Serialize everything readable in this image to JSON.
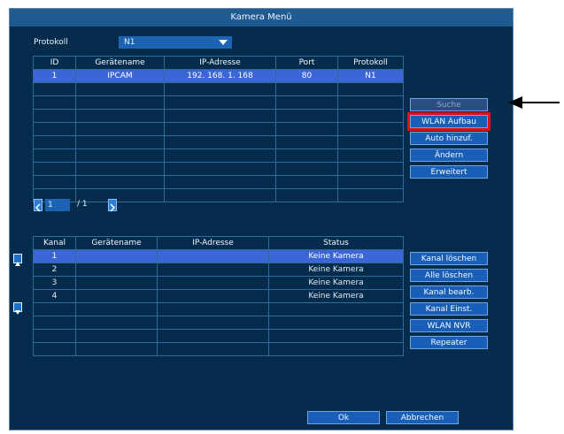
{
  "title": "Kamera Menü",
  "protokoll": {
    "label": "Protokoll",
    "value": "N1"
  },
  "cam_table": {
    "headers": [
      "ID",
      "Gerätename",
      "IP-Adresse",
      "Port",
      "Protokoll"
    ],
    "rows": [
      [
        "1",
        "IPCAM",
        "192. 168. 1. 168",
        "80",
        "N1"
      ]
    ]
  },
  "side_buttons": {
    "suche": "Suche",
    "wlan": "WLAN Aufbau",
    "auto": "Auto hinzuf.",
    "aendern": "Ändern",
    "erweitert": "Erweitert"
  },
  "pager": {
    "current": "1",
    "total": "/ 1"
  },
  "channel_table": {
    "headers": [
      "Kanal",
      "Gerätename",
      "IP-Adresse",
      "Status"
    ],
    "rows": [
      [
        "1",
        "",
        "",
        "Keine Kamera"
      ],
      [
        "2",
        "",
        "",
        "Keine Kamera"
      ],
      [
        "3",
        "",
        "",
        "Keine Kamera"
      ],
      [
        "4",
        "",
        "",
        "Keine Kamera"
      ]
    ]
  },
  "channel_buttons": {
    "kanal_loeschen": "Kanal löschen",
    "alle_loeschen": "Alle löschen",
    "kanal_bearb": "Kanal bearb.",
    "kanal_einst": "Kanal Einst.",
    "wlan_nvr": "WLAN NVR",
    "repeater": "Repeater"
  },
  "footer": {
    "ok": "Ok",
    "abbrechen": "Abbrechen"
  },
  "colors": {
    "background": "#052c4c",
    "titlebar": "#1f5a93",
    "selected_row": "#3c66d8",
    "highlight": "#e01010"
  },
  "icons": [
    "chevron-left-icon",
    "chevron-right-icon",
    "scroll-up-icon",
    "scroll-down-icon",
    "annotation-arrow-icon"
  ]
}
